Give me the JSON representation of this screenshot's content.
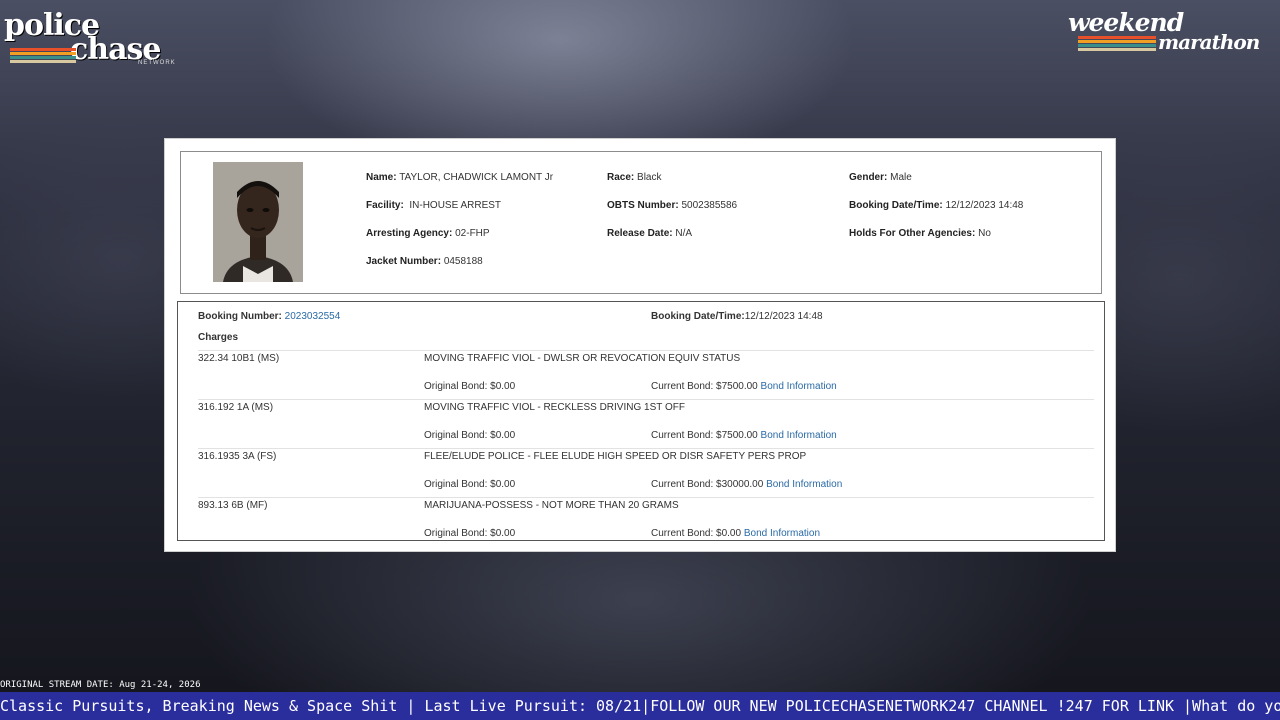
{
  "overlay": {
    "logo_left_line1": "police",
    "logo_left_line2": "chase",
    "logo_left_sub": "NETWORK",
    "logo_right_line1": "weekend",
    "logo_right_line2": "marathon",
    "stream_date": "ORIGINAL STREAM DATE: Aug 21-24, 2026",
    "ticker": "Classic Pursuits, Breaking News & Space Shit | Last Live Pursuit: 08/21|FOLLOW OUR NEW POLICECHASENETWORK247 CHANNEL !247 FOR LINK |What do you call a female police officer playing guitar? !joke",
    "stripe_colors": [
      "#e8502a",
      "#f2a024",
      "#3a8f8a",
      "#d8c9a0"
    ]
  },
  "inmate": {
    "name_label": "Name:",
    "name": "TAYLOR, CHADWICK LAMONT Jr",
    "race_label": "Race:",
    "race": "Black",
    "gender_label": "Gender:",
    "gender": "Male",
    "facility_label": "Facility:",
    "facility": "IN-HOUSE ARREST",
    "obts_label": "OBTS Number:",
    "obts": "5002385586",
    "booking_dt_label": "Booking Date/Time:",
    "booking_dt": "12/12/2023 14:48",
    "agency_label": "Arresting Agency:",
    "agency": "02-FHP",
    "release_label": "Release Date:",
    "release": "N/A",
    "holds_label": "Holds For Other Agencies:",
    "holds": "No",
    "jacket_label": "Jacket Number:",
    "jacket": "0458188"
  },
  "booking": {
    "number_label": "Booking Number:",
    "number": "2023032554",
    "datetime_label": "Booking Date/Time:",
    "datetime": "12/12/2023 14:48",
    "charges_label": "Charges",
    "charges": [
      {
        "statute": "322.34 10B1 (MS)",
        "description": "MOVING TRAFFIC VIOL - DWLSR OR REVOCATION EQUIV STATUS",
        "original_bond": "Original Bond: $0.00",
        "current_bond": "Current Bond: $7500.00",
        "bond_link": "Bond Information"
      },
      {
        "statute": "316.192 1A (MS)",
        "description": "MOVING TRAFFIC VIOL - RECKLESS DRIVING 1ST OFF",
        "original_bond": "Original Bond: $0.00",
        "current_bond": "Current Bond: $7500.00",
        "bond_link": "Bond Information"
      },
      {
        "statute": "316.1935 3A (FS)",
        "description": "FLEE/ELUDE POLICE - FLEE ELUDE HIGH SPEED OR DISR SAFETY PERS PROP",
        "original_bond": "Original Bond: $0.00",
        "current_bond": "Current Bond: $30000.00",
        "bond_link": "Bond Information"
      },
      {
        "statute": "893.13 6B (MF)",
        "description": "MARIJUANA-POSSESS - NOT MORE THAN 20 GRAMS",
        "original_bond": "Original Bond: $0.00",
        "current_bond": "Current Bond: $0.00",
        "bond_link": "Bond Information"
      }
    ]
  }
}
